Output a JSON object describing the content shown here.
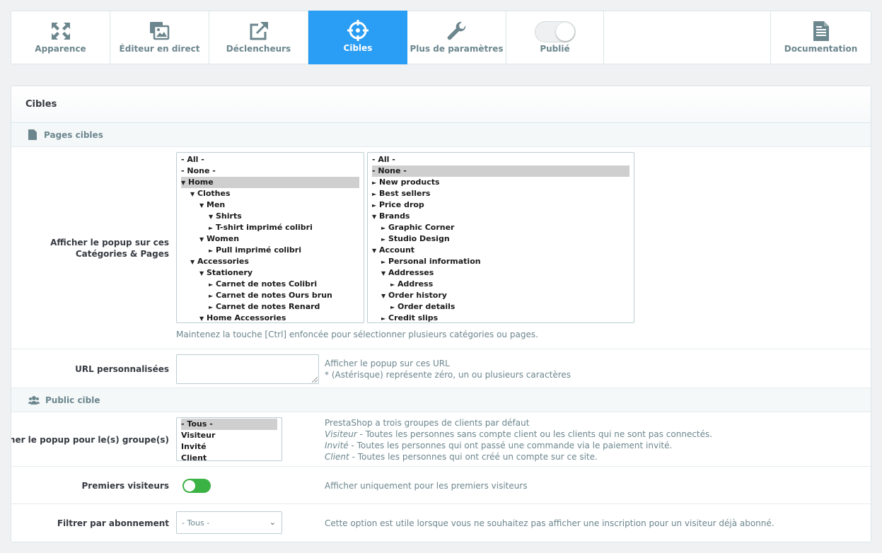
{
  "toolbar": {
    "items": [
      {
        "label": "Apparence",
        "icon": "expand-icon"
      },
      {
        "label": "Éditeur en direct",
        "icon": "images-icon"
      },
      {
        "label": "Déclencheurs",
        "icon": "external-link-icon"
      },
      {
        "label": "Cibles",
        "icon": "crosshair-icon"
      },
      {
        "label": "Plus de paramètres",
        "icon": "wrench-icon"
      }
    ],
    "published_label": "Publié",
    "documentation_label": "Documentation"
  },
  "panel": {
    "title": "Cibles",
    "pages_section": "Pages cibles",
    "categories_label_1": "Afficher le popup sur ces",
    "categories_label_2": "Catégories & Pages",
    "categories_list": [
      {
        "text": "- All -",
        "depth": 0,
        "arrow": ""
      },
      {
        "text": "- None -",
        "depth": 0,
        "arrow": ""
      },
      {
        "text": "Home",
        "depth": 0,
        "arrow": "▼",
        "selected": true
      },
      {
        "text": "Clothes",
        "depth": 1,
        "arrow": "▼"
      },
      {
        "text": "Men",
        "depth": 2,
        "arrow": "▼"
      },
      {
        "text": "Shirts",
        "depth": 3,
        "arrow": "▼"
      },
      {
        "text": "T-shirt imprimé colibri",
        "depth": 3,
        "arrow": "►"
      },
      {
        "text": "Women",
        "depth": 2,
        "arrow": "▼"
      },
      {
        "text": "Pull imprimé colibri",
        "depth": 3,
        "arrow": "►"
      },
      {
        "text": "Accessories",
        "depth": 1,
        "arrow": "▼"
      },
      {
        "text": "Stationery",
        "depth": 2,
        "arrow": "▼"
      },
      {
        "text": "Carnet de notes Colibri",
        "depth": 3,
        "arrow": "►"
      },
      {
        "text": "Carnet de notes Ours brun",
        "depth": 3,
        "arrow": "►"
      },
      {
        "text": "Carnet de notes Renard",
        "depth": 3,
        "arrow": "►"
      },
      {
        "text": "Home Accessories",
        "depth": 2,
        "arrow": "▼"
      }
    ],
    "pages_list": [
      {
        "text": "- All -",
        "depth": 0,
        "arrow": ""
      },
      {
        "text": "- None -",
        "depth": 0,
        "arrow": "",
        "selected": true
      },
      {
        "text": "New products",
        "depth": 0,
        "arrow": "►"
      },
      {
        "text": "Best sellers",
        "depth": 0,
        "arrow": "►"
      },
      {
        "text": "Price drop",
        "depth": 0,
        "arrow": "►"
      },
      {
        "text": "Brands",
        "depth": 0,
        "arrow": "▼"
      },
      {
        "text": "Graphic Corner",
        "depth": 1,
        "arrow": "►"
      },
      {
        "text": "Studio Design",
        "depth": 1,
        "arrow": "►"
      },
      {
        "text": "Account",
        "depth": 0,
        "arrow": "▼"
      },
      {
        "text": "Personal information",
        "depth": 1,
        "arrow": "►"
      },
      {
        "text": "Addresses",
        "depth": 1,
        "arrow": "▼"
      },
      {
        "text": "Address",
        "depth": 2,
        "arrow": "►"
      },
      {
        "text": "Order history",
        "depth": 1,
        "arrow": "▼"
      },
      {
        "text": "Order details",
        "depth": 2,
        "arrow": "►"
      },
      {
        "text": "Credit slips",
        "depth": 1,
        "arrow": "►"
      }
    ],
    "ctrl_help": "Maintenez la touche [Ctrl] enfoncée pour sélectionner plusieurs catégories ou pages.",
    "url_label": "URL personnalisées",
    "url_value": "",
    "url_help_1": "Afficher le popup sur ces URL",
    "url_help_2": "* (Astérisque) représente zéro, un ou plusieurs caractères",
    "audience_section": "Public cible",
    "groups_label": "Afficher le popup pour le(s) groupe(s)",
    "groups_list": [
      {
        "text": "- Tous -",
        "selected": true
      },
      {
        "text": "Visiteur"
      },
      {
        "text": "Invité"
      },
      {
        "text": "Client"
      }
    ],
    "groups_help_title": "PrestaShop a trois groupes de clients par défaut",
    "groups_help_visitor_name": "Visiteur",
    "groups_help_visitor_text": " - Toutes les personnes sans compte client ou les clients qui ne sont pas connectés.",
    "groups_help_guest_name": "Invité",
    "groups_help_guest_text": " - Toutes les personnes qui ont passé une commande via le paiement invité.",
    "groups_help_client_name": "Client",
    "groups_help_client_text": " - Toutes les personnes qui ont créé un compte sur ce site.",
    "first_visitors_label": "Premiers visiteurs",
    "first_visitors_on": true,
    "first_visitors_help": "Afficher uniquement pour les premiers visiteurs",
    "subscription_label": "Filtrer par abonnement",
    "subscription_value": "- Tous -",
    "subscription_help": "Cette option est utile lorsque vous ne souhaitez pas afficher une inscription pour un visiteur déjà abonné."
  },
  "colors": {
    "active_tab": "#2a9df4",
    "switch_on": "#3bb244"
  }
}
